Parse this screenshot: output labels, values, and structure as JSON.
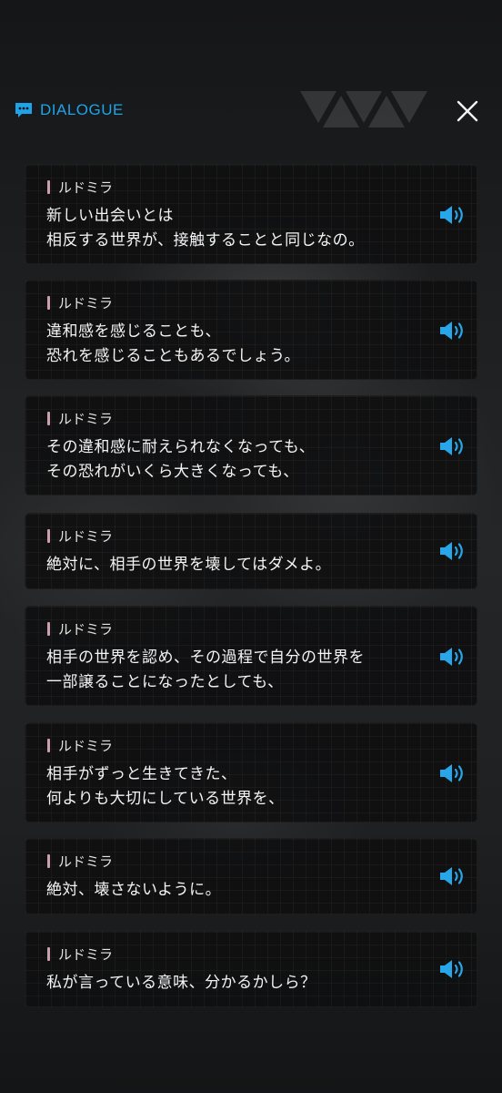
{
  "header": {
    "title": "DIALOGUE"
  },
  "colors": {
    "accent": "#1fa3e8",
    "speaker_bar": "#c9a0ab"
  },
  "icons": {
    "header": "chat-bubble-icon",
    "close": "close-icon",
    "voice": "speaker-volume-icon"
  },
  "dialogue": [
    {
      "speaker": "ルドミラ",
      "text": "新しい出会いとは\n相反する世界が、接触することと同じなの。"
    },
    {
      "speaker": "ルドミラ",
      "text": "違和感を感じることも、\n恐れを感じることもあるでしょう。"
    },
    {
      "speaker": "ルドミラ",
      "text": "その違和感に耐えられなくなっても、\nその恐れがいくら大きくなっても、"
    },
    {
      "speaker": "ルドミラ",
      "text": "絶対に、相手の世界を壊してはダメよ。"
    },
    {
      "speaker": "ルドミラ",
      "text": "相手の世界を認め、その過程で自分の世界を\n一部譲ることになったとしても、"
    },
    {
      "speaker": "ルドミラ",
      "text": "相手がずっと生きてきた、\n何よりも大切にしている世界を、"
    },
    {
      "speaker": "ルドミラ",
      "text": "絶対、壊さないように。"
    },
    {
      "speaker": "ルドミラ",
      "text": "私が言っている意味、分かるかしら？"
    }
  ]
}
